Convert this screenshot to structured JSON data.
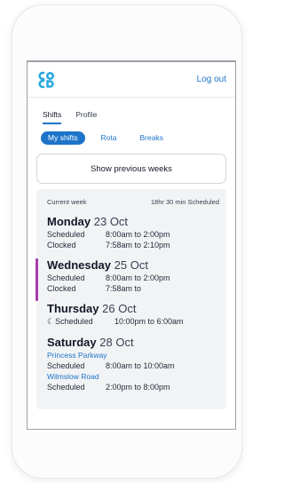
{
  "header": {
    "logout_label": "Log out",
    "logo_icon": "coop-logo-icon",
    "brand_color": "#1d74c9"
  },
  "tabs": [
    {
      "label": "Shifts",
      "active": true
    },
    {
      "label": "Profile",
      "active": false
    }
  ],
  "subnav": [
    {
      "label": "My shifts",
      "active": true
    },
    {
      "label": "Rota"
    },
    {
      "label": "Breaks"
    }
  ],
  "show_previous_label": "Show previous weeks",
  "week": {
    "label": "Current week",
    "summary": "18hr 30 min  Scheduled",
    "days": [
      {
        "name": "Monday",
        "date": "23 Oct",
        "rows": [
          {
            "k": "Scheduled",
            "v": "8:00am to 2:00pm"
          },
          {
            "k": "Clocked",
            "v": "7:58am to 2:10pm"
          }
        ]
      },
      {
        "name": "Wednesday",
        "date": "25 Oct",
        "highlight_color": "#a83da8",
        "rows": [
          {
            "k": "Scheduled",
            "v": "8:00am to 2:00pm"
          },
          {
            "k": "Clocked",
            "v": "7:58am to"
          }
        ]
      },
      {
        "name": "Thursday",
        "date": "26 Oct",
        "night_icon": "moon-icon",
        "rows": [
          {
            "k": "Scheduled",
            "v": "10:00pm to 6:00am"
          }
        ]
      },
      {
        "name": "Saturday",
        "date": "28 Oct",
        "locations": [
          {
            "name": "Princess Parkway",
            "k": "Scheduled",
            "v": "8:00am to 10:00am"
          },
          {
            "name": "Wilmslow Road",
            "k": "Scheduled",
            "v": "2:00pm to 8:00pm"
          }
        ]
      }
    ]
  }
}
